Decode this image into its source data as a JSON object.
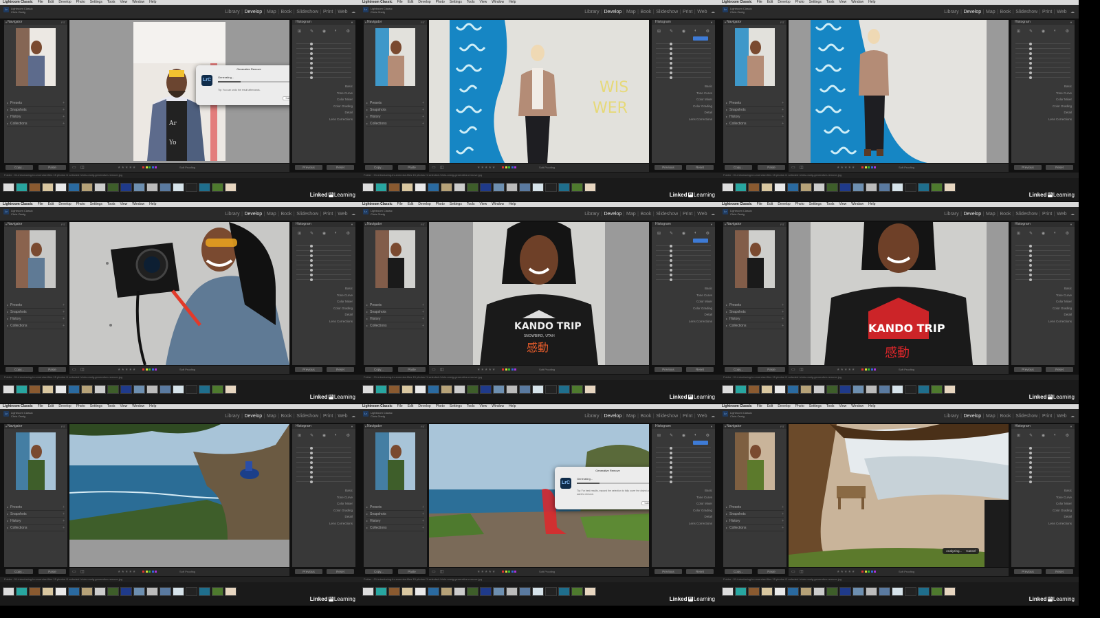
{
  "os_menu": {
    "app": "Lightroom Classic",
    "items": [
      "File",
      "Edit",
      "Develop",
      "Photo",
      "Settings",
      "Tools",
      "View",
      "Window",
      "Help"
    ]
  },
  "lr": {
    "logo": "Lr",
    "subtitle": "Lightroom Classic",
    "user": "Chris Orwig",
    "modules": [
      "Library",
      "Develop",
      "Map",
      "Book",
      "Slideshow",
      "Print",
      "Web"
    ],
    "active_module": "Develop"
  },
  "left_panel": {
    "navigator": "Navigator",
    "fit": "FIT",
    "sections": [
      "Presets",
      "Snapshots",
      "History",
      "Collections"
    ],
    "copy": "Copy...",
    "paste": "Paste"
  },
  "right_panel": {
    "histogram": "Histogram",
    "previous": "Previous",
    "reset": "Reset",
    "basic_sections": [
      "Basic",
      "Tone Curve",
      "Color Mixer",
      "Color Grading",
      "Detail",
      "Lens Corrections",
      "Transform",
      "Lens Blur",
      "Effects",
      "Calibration"
    ]
  },
  "toolbar": {
    "stars": "★★★★★",
    "soft_proofing": "Soft Proofing"
  },
  "pathbar": {
    "text": "Folder : 01-introducing-lrc-exercise-files   15 photos /1 selected /chris-orwig-generative-remove.jpg"
  },
  "branding": {
    "linkedin": "Linked",
    "in": "in",
    "learning": "Learning"
  },
  "dialogs": {
    "title": "Generative Remove",
    "generating": "Generating...",
    "tip1": "Tip: You can undo the result afterwards.",
    "tip2": "Tip: For best results, expand the selection to fully cover the object you want to remove.",
    "cancel": "Cancel"
  },
  "analyzing": {
    "text": "Analyzing...",
    "cancel": "Cancel"
  },
  "photo_scenes": [
    "man-jacket-removal",
    "woman-blue-mural",
    "woman-blue-mural-wide",
    "woman-camera",
    "woman-tshirt",
    "woman-tshirt-red",
    "ocean-reading",
    "ocean-removing",
    "tree-bench"
  ],
  "colors": {
    "accent": "#3e7bd6",
    "panel": "#383838",
    "mask_red": "#e0262a"
  }
}
